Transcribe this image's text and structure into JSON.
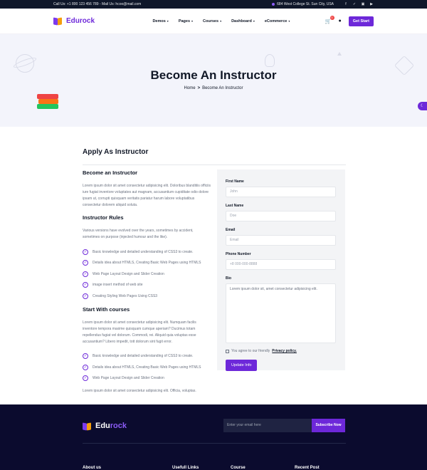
{
  "topbar": {
    "contact": "Call Us: +1 800 123 456 789 - Mail Us: hcoo@mail.com",
    "address": "684 West College St. Sun City, USA",
    "social_icons": [
      "facebook-icon",
      "twitter-icon",
      "instagram-icon",
      "youtube-icon"
    ],
    "social_glyphs": [
      "f",
      "✓",
      "▣",
      "▶"
    ]
  },
  "header": {
    "brand": "Edurock",
    "nav": [
      "Demos",
      "Pages",
      "Courses",
      "Dashboard",
      "eCommerce"
    ],
    "caret": "▾",
    "cart_count": "0",
    "get_start": "Get Start"
  },
  "hero": {
    "title": "Become An Instructor",
    "breadcrumb_home": "Home",
    "breadcrumb_sep": ">",
    "breadcrumb_current": "Become An Instructor",
    "moon_glyph": "☾"
  },
  "main": {
    "title": "Apply As Instructor",
    "become": {
      "heading": "Become an Instructor",
      "text": "Lorem ipsum dolor sit amet consectetur adipisicing elit. Doloribus blanditiis officiis iure fugiat inventore voluptates aut magnam, accusantium cupiditate odio dolore ipsam ut, corrupti quisquam veritatis pariatur harum labore voluptatibus consectetur dolorem aliquid soluta."
    },
    "rules": {
      "heading": "Instructor Rules",
      "text": "Various versions have evolved over the years, sometimes by accident, sometimes on purpose (injected humour and the like).",
      "items": [
        "Basic knowledge and detailed understanding of CSS3 to create.",
        "Details idea about HTMLS, Creating Basic Web Pages using HTMLS",
        "Web Page Layout Design and Slider Creation",
        "image insert method of web site",
        "Creating Styling Web Pages Using CSS3"
      ]
    },
    "start": {
      "heading": "Start With courses",
      "text": "Lorem ipsum dolor sit amet consectetur adipisicing elit. Numquam facilis inventore tempora maxime quisquam cumque aperiam? Ducimus totam repellendus fugiat vel dolorum. Commodi, rei. Aliquid quia voluptas esse accusantium? Libero impedit, tott dolorum sint fugit error.",
      "items": [
        "Basic knowledge and detailed understanding of CSS3 to create.",
        "Details idea about HTMLS, Creating Basic Web Pages using HTMLS",
        "Web Page Layout Design and Slider Creation"
      ],
      "closing": "Lorem ipsum dolor sit amet consectetur adipisicing elit. Officia, voluptas."
    },
    "check_glyph": "✓"
  },
  "form": {
    "first_name_label": "First Name",
    "first_name_placeholder": "John",
    "last_name_label": "Last Name",
    "last_name_placeholder": "Doe",
    "email_label": "Email",
    "email_placeholder": "Email",
    "phone_label": "Phone Number",
    "phone_placeholder": "+8 000-000-8888",
    "bio_label": "Bio",
    "bio_value": "Lorem ipsum dolor sit, amet consectetur adipisicing elit.",
    "agree_text": "You agree to our friendly",
    "agree_link": "Privacy policy.",
    "submit": "Update Info"
  },
  "footer": {
    "brand_main": "Edu",
    "brand_accent": "rock",
    "subscribe_placeholder": "Enter your email here",
    "subscribe_button": "Subscribe Now",
    "columns": [
      "About us",
      "Usefull Links",
      "Course",
      "Recent Post"
    ]
  }
}
